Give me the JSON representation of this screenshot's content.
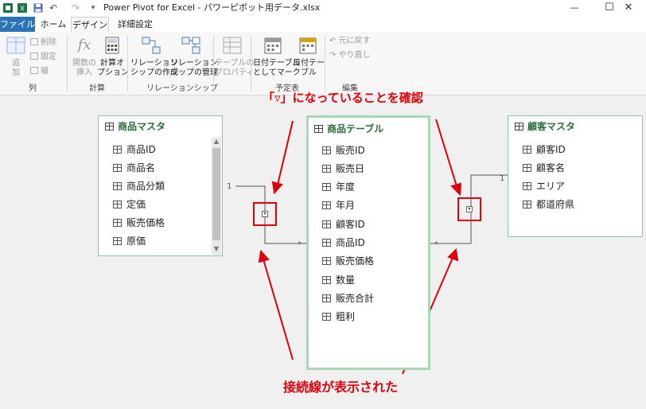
{
  "window": {
    "title": "Power Pivot for Excel - パワーピボット用データ.xlsx",
    "controls": {
      "minimize": "—",
      "maximize": "☐",
      "close": "✕"
    }
  },
  "qat": {
    "undo": "↶",
    "redo": "↷",
    "more": "▾"
  },
  "tabs": {
    "file": "ファイル",
    "home": "ホーム",
    "design": "デザイン",
    "advanced": "詳細設定"
  },
  "ribbon": {
    "columns": {
      "add": "追\n加",
      "delete": "削除",
      "freeze": "固定",
      "width": "幅",
      "group": "列"
    },
    "calc": {
      "insert_function": "関数の\n挿入",
      "calc_options": "計算オ\nプション",
      "group": "計算"
    },
    "relationships": {
      "create": "リレーション\nシップの作成",
      "manage": "リレーション\nシップの管理",
      "group": "リレーションシップ"
    },
    "table_props": "テーブルの\nプロパティ",
    "date": {
      "mark": "日付テーブル\nとしてマーク",
      "date_table": "日付テー\nブル",
      "group": "予定表"
    },
    "edit": {
      "undo": "元に戻す",
      "redo": "やり直し",
      "group": "編集"
    }
  },
  "tables": {
    "product_master": {
      "name": "商品マスタ",
      "fields": [
        "商品ID",
        "商品名",
        "商品分類",
        "定価",
        "販売価格",
        "原価"
      ]
    },
    "product_table": {
      "name": "商品テーブル",
      "fields": [
        "販売ID",
        "販売日",
        "年度",
        "年月",
        "顧客ID",
        "商品ID",
        "販売価格",
        "数量",
        "販売合計",
        "粗利"
      ]
    },
    "customer_master": {
      "name": "顧客マスタ",
      "fields": [
        "顧客ID",
        "顧客名",
        "エリア",
        "都道府県"
      ]
    }
  },
  "relationships": {
    "left": {
      "one": "1",
      "many": "*"
    },
    "right": {
      "one": "1",
      "many": "*"
    }
  },
  "annotations": {
    "top": "「▿」になっていることを確認",
    "bottom": "接続線が表示された"
  },
  "colors": {
    "accent": "#2b74b9",
    "annotation": "#e0000b",
    "table_border": "#8fc1a3",
    "table_title": "#2e6b3e"
  }
}
